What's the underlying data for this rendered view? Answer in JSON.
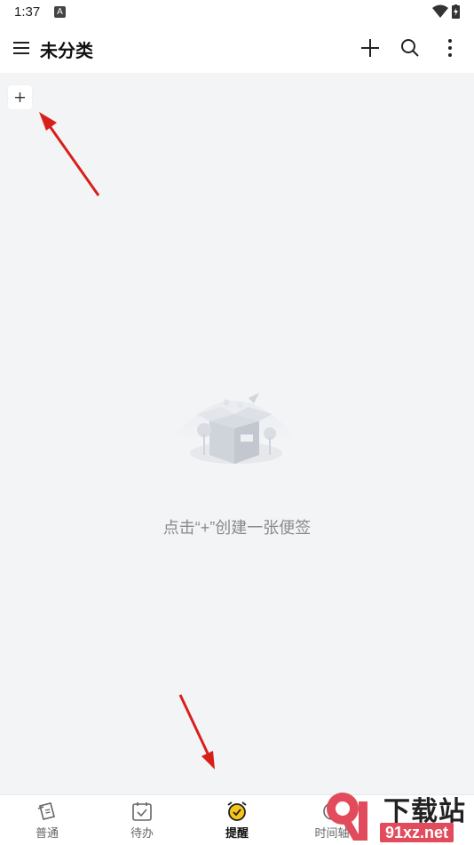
{
  "status_bar": {
    "time": "1:37",
    "notification_glyph": "A"
  },
  "app_bar": {
    "title": "未分类"
  },
  "add_note": {
    "symbol": "+"
  },
  "empty_state": {
    "hint": "点击“+”创建一张便签"
  },
  "bottom_nav": {
    "items": [
      {
        "label": "普通",
        "icon": "note-icon",
        "active": false
      },
      {
        "label": "待办",
        "icon": "calendar-check-icon",
        "active": false
      },
      {
        "label": "提醒",
        "icon": "alarm-clock-icon",
        "active": true
      },
      {
        "label": "时间轴",
        "icon": "timeline-icon",
        "active": false
      }
    ]
  },
  "watermark": {
    "line1": "下载站",
    "line2": "91xz.net"
  },
  "colors": {
    "accent_yellow": "#f5c518",
    "arrow_red": "#d8201b",
    "background": "#f3f4f6"
  }
}
